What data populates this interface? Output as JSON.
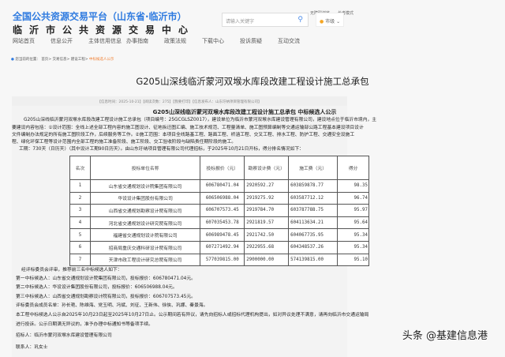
{
  "header": {
    "top_links": [
      "无障碍浏览",
      "长者模式"
    ],
    "brand_title": "全国公共资源交易平台（山东省·临沂市）",
    "brand_subtitle": "临沂市公共资源交易中心",
    "search_placeholder": "请输入关键字",
    "city_select": "市级"
  },
  "nav": [
    "网站首页",
    "信息公开",
    "主体信用信息",
    "办事指南",
    "政策法规",
    "下载中心",
    "投诉质疑",
    "互动交流"
  ],
  "breadcrumb": {
    "label": "您当前的位置：",
    "items": [
      "首页",
      "交易信息",
      "建设工程"
    ],
    "current": "中标候选人公示"
  },
  "article": {
    "title": "G205山深线临沂蒙河双堠水库段改建工程设计施工总承包",
    "meta": "【信息时间：2025-10-21】【阅读次数：275】【我要打印】【信息发布人：山东玗纳项目管理有限公司】",
    "heading": "G205山深线临沂蒙河双堠水库段改建工程设计施工总承包  中标候选人公示",
    "paragraph_lines": [
      "G205山深线临沂蒙河双堠水库段改建工程设计施工总承包（项目编号：25GCGLSZ0017），建设单位为临沂市蒙河双堠水库建设管理有限公司，建设地点位于临沂市境内，主",
      "要建设内容包括：①设计范围：全线上述全部工程内容的施工图设计、征地拆迁图汇编、施工技术规范、工程量清单、施工图预算编制等交通运输部公路工程基本建设项目设计",
      "文件编制办法规定的所有施工图阶段工作，后续服务等工作。②施工范围：本项目全线路基工程、路面工程、桥涵工程、交叉工程、排水工程、防护工程、交通安全设施工",
      "程、绿化环保工程等设计范围内全部工程的施工准备阶段、施工阶段、交工验收阶段与缺陷责任期阶段的施工。",
      "工期：730天（日历天）（其中设计工期90日历天）。由山东玗纳项目管理有限公司代理招标，于2025年10月21日开标，得分排名情况如下："
    ],
    "table": {
      "headers": [
        "名次",
        "投标单位名称",
        "投标报价（元）",
        "勘察设计费（元）",
        "施工费（元）",
        "得分"
      ],
      "rows": [
        [
          "1",
          "山东省交通规划设计院集团有限公司",
          "606780471.04",
          "2920592.27",
          "603859878.77",
          "98.35"
        ],
        [
          "2",
          "华设设计集团股份有限公司",
          "606506988.04",
          "2919275.92",
          "603587712.12",
          "96.74"
        ],
        [
          "3",
          "山西省交通规划勘察设计院有限公司",
          "606707573.45",
          "2919784.70",
          "603787788.75",
          "95.97"
        ],
        [
          "4",
          "河北省交通规划设计研究院有限公司",
          "607035453.78",
          "2921819.57",
          "604113634.21",
          "95.64"
        ],
        [
          "5",
          "福建省交通规划设计院有限公司",
          "606989478.45",
          "2921742.50",
          "604067735.95",
          "95.34"
        ],
        [
          "6",
          "招商局重庆交通科研设计院有限公司",
          "607271492.94",
          "2922955.68",
          "604348537.26",
          "95.34"
        ],
        [
          "7",
          "天津市政工程设计研究总院有限公司",
          "577039815.00",
          "2900000.00",
          "574139815.00",
          "95.10"
        ]
      ]
    },
    "after_lines": [
      "经评标委员会评审，推荐前三名中标候选人如下：",
      "第一中标候选人：山东省交通规划设计院集团有限公司，投标报价：606780471.04元。",
      "第二中标候选人：华设设计集团股份有限公司，投标报价：606506988.04元。",
      "第三中标候选人：山西省交通规划勘察设计院有限公司，投标报价：606707573.45元。",
      "评标委员会成员名单：孙长艳、陈维海、党玉明、冯斌、刘征、王新伟、徐侠、巩娜、秦景海。",
      "本工程中标候选人公示自2025年10月23日起至2025年10月27日止。公示期间若有异议，请先向招标人或招标代理机构提出，如对异议处理不满意，请再向临沂市交通运输局",
      "进行投诉。公示日期满无异议的，准予办理中标通知书等备项手续。",
      "招标人：临沂市蒙河双堠水库建设管理有限公司",
      "联系人：巩女士"
    ]
  },
  "watermark": "头条 @基建信息港"
}
